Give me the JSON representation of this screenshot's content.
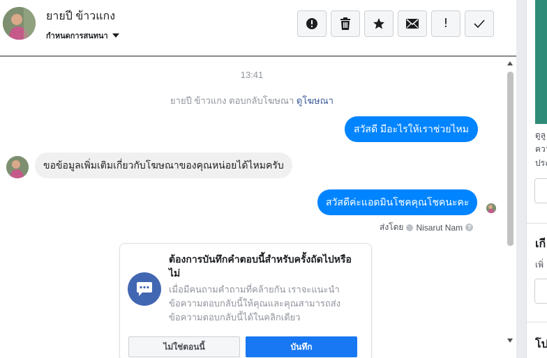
{
  "header": {
    "name": "ยายปี ข้าวแกง",
    "conversation_settings": "กำหนดการสนทนา",
    "toolbar": [
      {
        "icon": "spam-icon",
        "label": "mark spam"
      },
      {
        "icon": "trash-icon",
        "label": "delete"
      },
      {
        "icon": "star-icon",
        "label": "star"
      },
      {
        "icon": "mail-icon",
        "label": "mark unread"
      },
      {
        "icon": "exclamation-icon",
        "label": "follow up"
      },
      {
        "icon": "check-icon",
        "label": "done"
      }
    ]
  },
  "conversation": {
    "timestamp": "13:41",
    "ad_reply_text": "ยายปี ข้าวแกง ตอบกลับโฆษณา",
    "ad_reply_link": "ดูโฆษณา",
    "messages": [
      {
        "direction": "out",
        "text": "สวัสดี มีอะไรให้เราช่วยไหม"
      },
      {
        "direction": "in",
        "text": "ขอข้อมูลเพิ่มเติมเกี่ยวกับโฆษณาของคุณหน่อยได้ไหมครับ"
      },
      {
        "direction": "out",
        "text": "สวัสดีค่ะแอดมินโชคคุณโชคนะคะ"
      }
    ],
    "sent_by_prefix": "ส่งโดย",
    "sent_by_name": "Nisarut Nam"
  },
  "save_card": {
    "title": "ต้องการบันทึกคำตอบนี้สำหรับครั้งถัดไปหรือไม่",
    "body": "เมื่อมีคนถามคำถามที่คล้ายกัน เราจะแนะนำข้อความตอบกลับนี้ให้คุณและคุณสามารถส่งข้อความตอบกลับนี้ได้ในคลิกเดียว",
    "btn_no": "ไม่ใช่ตอนนี้",
    "btn_save": "บันทึก"
  },
  "right_panel": {
    "line1": "ดูลู",
    "line2": "ควา",
    "line3": "ประ",
    "heading1": "เกี",
    "line4": "เพิ่",
    "heading2": "โป"
  },
  "colors": {
    "accent": "#0084ff",
    "button_blue": "#1877f2",
    "card_icon": "#4267b2",
    "muted_text": "#90949c",
    "link": "#385898"
  }
}
